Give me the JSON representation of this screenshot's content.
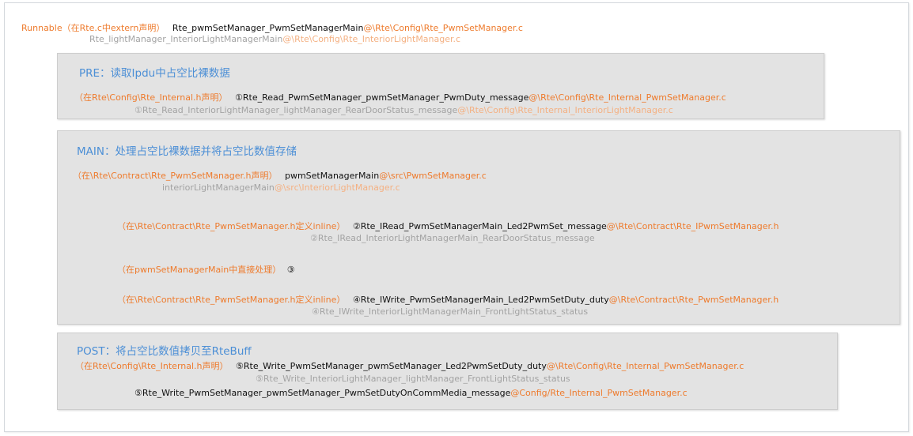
{
  "header": {
    "runnable_label": "Runnable（在Rte.c中extern声明）",
    "main_fn": "Rte_pwmSetManager_PwmSetManagerMain",
    "main_path": "@\\Rte\\Config\\Rte_PwmSetManager.c",
    "alt_fn": "Rte_lightManager_InteriorLightManagerMain",
    "alt_path": "@\\Rte\\Config\\Rte_InteriorLightManager.c"
  },
  "pre": {
    "title": "PRE：读取Ipdu中占空比裸数据",
    "decl": "（在Rte\\Config\\Rte_Internal.h声明）",
    "fn": "①Rte_Read_PwmSetManager_pwmSetManager_PwmDuty_message",
    "path": "@\\Rte\\Config\\Rte_Internal_PwmSetManager.c",
    "alt_fn": "①Rte_Read_InteriorLightManager_lightManager_RearDoorStatus_message",
    "alt_path": "@\\Rte\\Config\\Rte_Internal_InteriorLightManager.c"
  },
  "main": {
    "title": "MAIN：处理占空比裸数据并将占空比数值存储",
    "decl": "（在\\Rte\\Contract\\Rte_PwmSetManager.h声明）",
    "fn": "pwmSetManagerMain",
    "path": "@\\src\\PwmSetManager.c",
    "alt_fn": "interiorLightManagerMain",
    "alt_path": "@\\src\\InteriorLightManager.c",
    "step2_decl": "（在\\Rte\\Contract\\Rte_PwmSetManager.h定义inline）",
    "step2_fn": "②Rte_IRead_PwmSetManagerMain_Led2PwmSet_message",
    "step2_path": "@\\Rte\\Contract\\Rte_IPwmSetManager.h",
    "step2_alt": "②Rte_IRead_InteriorLightManagerMain_RearDoorStatus_message",
    "step3_decl": "（在pwmSetManagerMain中直接处理）",
    "step3_fn": "③",
    "step4_decl": "（在\\Rte\\Contract\\Rte_PwmSetManager.h定义inline）",
    "step4_fn": "④Rte_IWrite_PwmSetManagerMain_Led2PwmSetDuty_duty",
    "step4_path": "@\\Rte\\Contract\\Rte_PwmSetManager.h",
    "step4_alt": "④Rte_IWrite_InteriorLightManagerMain_FrontLightStatus_status"
  },
  "post": {
    "title": "POST：将占空比数值拷贝至RteBuff",
    "decl": "（在Rte\\Config\\Rte_Internal.h声明）",
    "fn": "⑤Rte_Write_PwmSetManager_pwmSetManager_Led2PwmSetDuty_duty",
    "path": "@\\Rte\\Config\\Rte_Internal_PwmSetManager.c",
    "alt_fn": "⑤Rte_Write_InteriorLightManager_lightManager_FrontLightStatus_status",
    "extra_fn": "⑤Rte_Write_PwmSetManager_pwmSetManager_PwmSetDutyOnCommMedia_message",
    "extra_path": "@Config/Rte_Internal_PwmSetManager.c"
  },
  "colors": {
    "orange": "#ee7b2d",
    "light_orange": "#f4b183",
    "gray_text": "#a3a3a3",
    "title_blue": "#4c8fd6",
    "box_fill": "#e3e3e3"
  }
}
